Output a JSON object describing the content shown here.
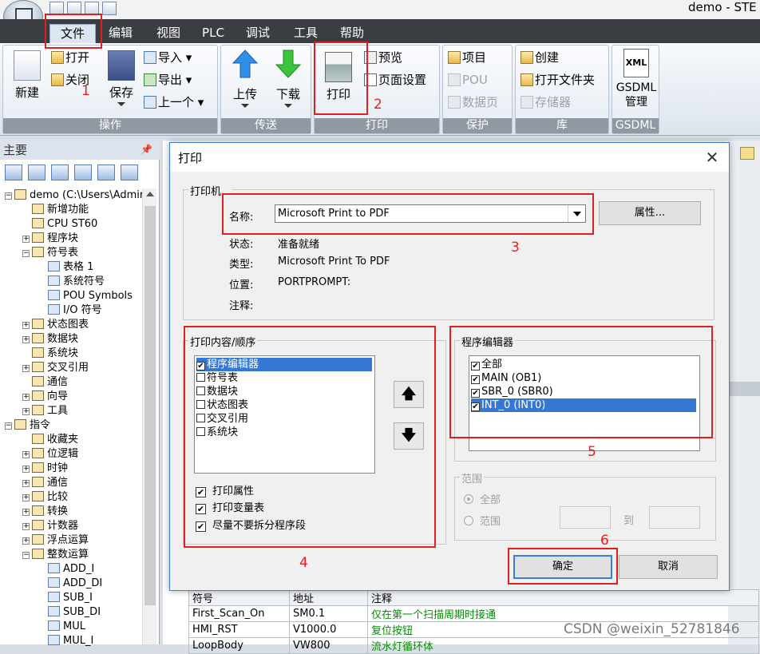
{
  "window": {
    "title": "demo - STE"
  },
  "ribbon_tabs": [
    "文件",
    "编辑",
    "视图",
    "PLC",
    "调试",
    "工具",
    "帮助"
  ],
  "ribbon": {
    "groups": {
      "operation": {
        "label": "操作",
        "new": "新建",
        "open": "打开",
        "close": "关闭",
        "save": "保存",
        "import": "导入",
        "export": "导出",
        "previous": "上一个"
      },
      "transfer": {
        "label": "传送",
        "upload": "上传",
        "download": "下载"
      },
      "print": {
        "label": "打印",
        "print": "打印",
        "preview": "预览",
        "page_setup": "页面设置"
      },
      "protect": {
        "label": "保护",
        "project": "项目",
        "pou": "POU",
        "data_page": "数据页"
      },
      "library": {
        "label": "库",
        "create": "创建",
        "open_folder": "打开文件夹",
        "memory": "存储器"
      },
      "gsdml": {
        "label": "GSDML",
        "manage_line1": "GSDML",
        "manage_line2": "管理",
        "xml": "XML"
      }
    }
  },
  "annotations": [
    "1",
    "2",
    "3",
    "4",
    "5",
    "6"
  ],
  "left_panel": {
    "title": "主要",
    "pin": "ᵖ",
    "tree": [
      {
        "label": "demo (C:\\Users\\Admir",
        "level": 0,
        "exp": "−"
      },
      {
        "label": "新增功能",
        "level": 1,
        "exp": ""
      },
      {
        "label": "CPU ST60",
        "level": 1,
        "exp": ""
      },
      {
        "label": "程序块",
        "level": 1,
        "exp": "+"
      },
      {
        "label": "符号表",
        "level": 1,
        "exp": "−"
      },
      {
        "label": "表格 1",
        "level": 2,
        "exp": ""
      },
      {
        "label": "系统符号",
        "level": 2,
        "exp": ""
      },
      {
        "label": "POU Symbols",
        "level": 2,
        "exp": ""
      },
      {
        "label": "I/O 符号",
        "level": 2,
        "exp": ""
      },
      {
        "label": "状态图表",
        "level": 1,
        "exp": "+"
      },
      {
        "label": "数据块",
        "level": 1,
        "exp": "+"
      },
      {
        "label": "系统块",
        "level": 1,
        "exp": ""
      },
      {
        "label": "交叉引用",
        "level": 1,
        "exp": "+"
      },
      {
        "label": "通信",
        "level": 1,
        "exp": ""
      },
      {
        "label": "向导",
        "level": 1,
        "exp": "+"
      },
      {
        "label": "工具",
        "level": 1,
        "exp": "+"
      },
      {
        "label": "指令",
        "level": 0,
        "exp": "−"
      },
      {
        "label": "收藏夹",
        "level": 1,
        "exp": ""
      },
      {
        "label": "位逻辑",
        "level": 1,
        "exp": "+"
      },
      {
        "label": "时钟",
        "level": 1,
        "exp": "+"
      },
      {
        "label": "通信",
        "level": 1,
        "exp": "+"
      },
      {
        "label": "比较",
        "level": 1,
        "exp": "+"
      },
      {
        "label": "转换",
        "level": 1,
        "exp": "+"
      },
      {
        "label": "计数器",
        "level": 1,
        "exp": "+"
      },
      {
        "label": "浮点运算",
        "level": 1,
        "exp": "+"
      },
      {
        "label": "整数运算",
        "level": 1,
        "exp": "−"
      },
      {
        "label": "ADD_I",
        "level": 2,
        "exp": ""
      },
      {
        "label": "ADD_DI",
        "level": 2,
        "exp": ""
      },
      {
        "label": "SUB_I",
        "level": 2,
        "exp": ""
      },
      {
        "label": "SUB_DI",
        "level": 2,
        "exp": ""
      },
      {
        "label": "MUL",
        "level": 2,
        "exp": ""
      },
      {
        "label": "MUL_I",
        "level": 2,
        "exp": ""
      }
    ]
  },
  "symbol_table": {
    "headers": [
      "符号",
      "地址",
      "注释"
    ],
    "rows": [
      [
        "First_Scan_On",
        "SM0.1",
        "仅在第一个扫描周期时接通"
      ],
      [
        "HMI_RST",
        "V1000.0",
        "复位按钮"
      ],
      [
        "LoopBody",
        "VW800",
        "流水灯循环体"
      ]
    ]
  },
  "dialog": {
    "title": "打印",
    "close": "✕",
    "printer_group": "打印机...",
    "name_label": "名称:",
    "printer_name": "Microsoft Print to PDF",
    "properties_button": "属性...",
    "status_label": "状态:",
    "status_value": "准备就绪",
    "type_label": "类型:",
    "type_value": "Microsoft Print To PDF",
    "location_label": "位置:",
    "location_value": "PORTPROMPT:",
    "comment_label": "注释:",
    "content_group": "打印内容/顺序",
    "content_items": [
      {
        "label": "程序编辑器",
        "checked": "✔",
        "selected": true
      },
      {
        "label": "符号表",
        "checked": "",
        "selected": false
      },
      {
        "label": "数据块",
        "checked": "",
        "selected": false
      },
      {
        "label": "状态图表",
        "checked": "",
        "selected": false
      },
      {
        "label": "交叉引用",
        "checked": "",
        "selected": false
      },
      {
        "label": "系统块",
        "checked": "",
        "selected": false
      }
    ],
    "move_up": "🡅",
    "move_down": "🡇",
    "options": [
      {
        "label": "打印属性",
        "checked": "✔"
      },
      {
        "label": "打印变量表",
        "checked": "✔"
      },
      {
        "label": "尽量不要拆分程序段",
        "checked": "✔"
      }
    ],
    "editor_group": "程序编辑器",
    "editor_items": [
      {
        "label": "全部",
        "checked": "✔",
        "selected": false
      },
      {
        "label": "MAIN (OB1)",
        "checked": "✔",
        "selected": false
      },
      {
        "label": "SBR_0 (SBR0)",
        "checked": "✔",
        "selected": false
      },
      {
        "label": "INT_0 (INT0)",
        "checked": "✔",
        "selected": true
      }
    ],
    "range_group": "范围",
    "range_all": "全部",
    "range_range": "范围",
    "range_to": "到",
    "ok_button": "确定",
    "cancel_button": "取消"
  },
  "watermark": "CSDN @weixin_52781846",
  "colors": {
    "highlight_red": "#e02020",
    "selection_blue": "#3578d4",
    "dialog_border": "#3a7fd5"
  }
}
